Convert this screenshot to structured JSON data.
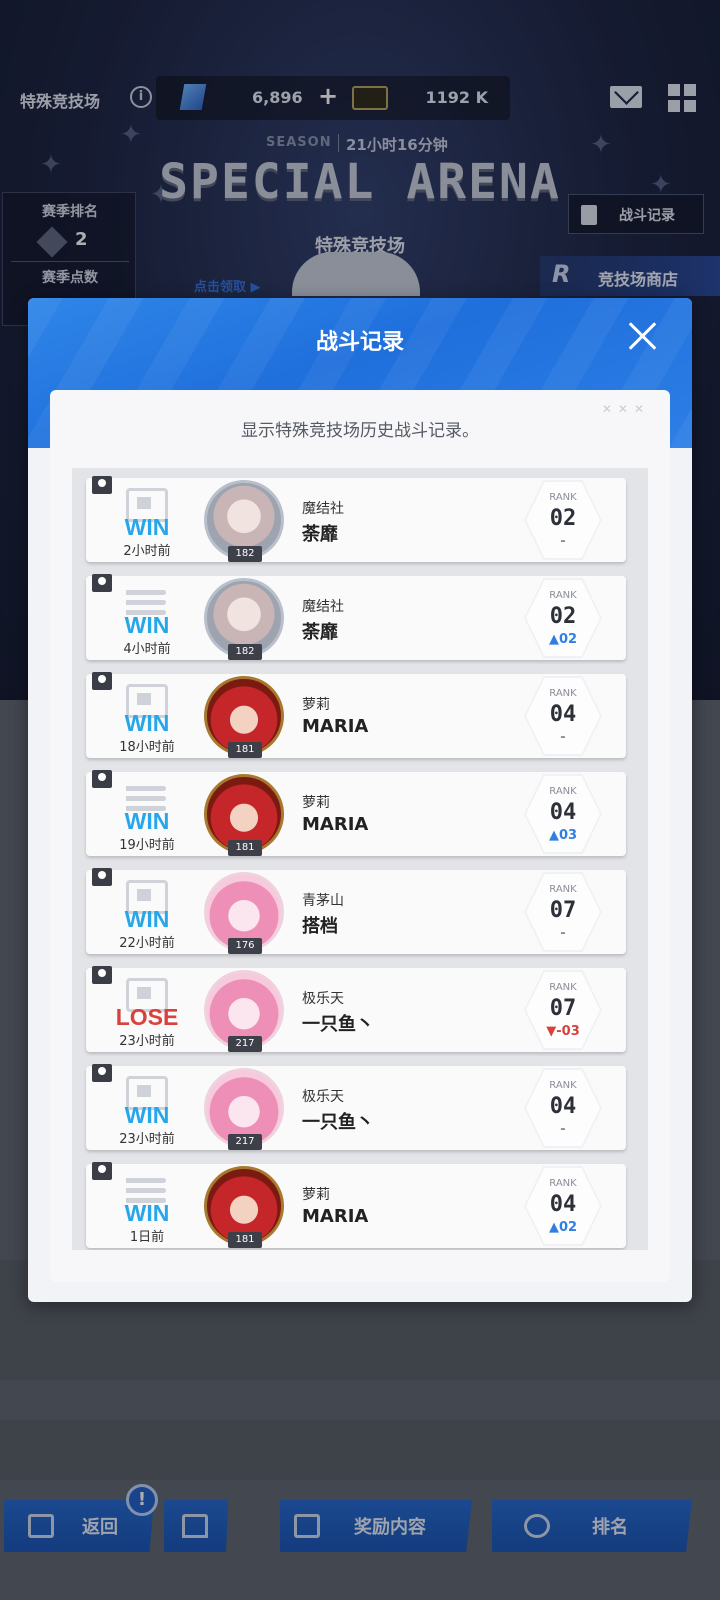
{
  "topbar": {
    "title": "特殊竞技场",
    "gems": "6,896",
    "coins": "1192 K"
  },
  "arena": {
    "season_label": "SEASON",
    "season_timer": "21小时16分钟",
    "title": "SPECIAL ARENA",
    "subtitle": "特殊竞技场",
    "season_rank_label": "赛季排名",
    "season_rank_value": "2",
    "season_points_label": "赛季点数",
    "record_button": "战斗记录",
    "shop_button": "竞技场商店",
    "claim_text": "点击领取 ▶"
  },
  "modal": {
    "title": "战斗记录",
    "description": "显示特殊竞技场历史战斗记录。",
    "rank_label": "RANK",
    "records": [
      {
        "result": "WIN",
        "time": "2小时前",
        "mode": "flag",
        "avatar": "silver",
        "level": "182",
        "guild": "魔结社",
        "player": "荼靡",
        "rank": "02",
        "change": "-",
        "change_dir": "none"
      },
      {
        "result": "WIN",
        "time": "4小时前",
        "mode": "bullets",
        "avatar": "silver",
        "level": "182",
        "guild": "魔结社",
        "player": "荼靡",
        "rank": "02",
        "change": "▲02",
        "change_dir": "up"
      },
      {
        "result": "WIN",
        "time": "18小时前",
        "mode": "flag",
        "avatar": "red",
        "level": "181",
        "guild": "萝莉",
        "player": "MARIA",
        "rank": "04",
        "change": "-",
        "change_dir": "none"
      },
      {
        "result": "WIN",
        "time": "19小时前",
        "mode": "bullets",
        "avatar": "red",
        "level": "181",
        "guild": "萝莉",
        "player": "MARIA",
        "rank": "04",
        "change": "▲03",
        "change_dir": "up"
      },
      {
        "result": "WIN",
        "time": "22小时前",
        "mode": "flag",
        "avatar": "pink",
        "level": "176",
        "guild": "青茅山",
        "player": "搭档",
        "rank": "07",
        "change": "-",
        "change_dir": "none"
      },
      {
        "result": "LOSE",
        "time": "23小时前",
        "mode": "flag",
        "avatar": "pink",
        "level": "217",
        "guild": "极乐天",
        "player": "一只鱼丶",
        "rank": "07",
        "change": "▼-03",
        "change_dir": "down"
      },
      {
        "result": "WIN",
        "time": "23小时前",
        "mode": "flag",
        "avatar": "pink",
        "level": "217",
        "guild": "极乐天",
        "player": "一只鱼丶",
        "rank": "04",
        "change": "-",
        "change_dir": "none"
      },
      {
        "result": "WIN",
        "time": "1日前",
        "mode": "bullets",
        "avatar": "red",
        "level": "181",
        "guild": "萝莉",
        "player": "MARIA",
        "rank": "04",
        "change": "▲02",
        "change_dir": "up"
      }
    ]
  },
  "bottom_bar": {
    "back": "返回",
    "rewards": "奖励内容",
    "ranking": "排名",
    "alert": "!"
  }
}
